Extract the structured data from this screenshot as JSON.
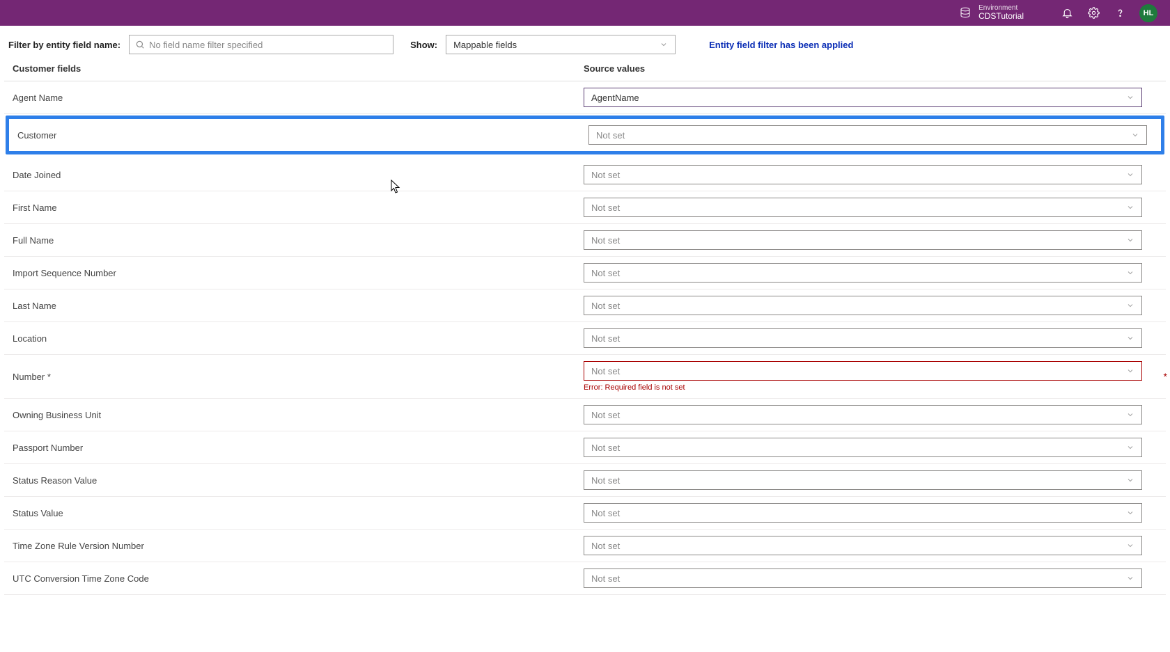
{
  "header": {
    "env_label": "Environment",
    "env_name": "CDSTutorial",
    "avatar_initials": "HL"
  },
  "filterbar": {
    "filter_label": "Filter by entity field name:",
    "search_placeholder": "No field name filter specified",
    "show_label": "Show:",
    "show_value": "Mappable fields",
    "applied_msg": "Entity field filter has been applied"
  },
  "columns": {
    "customer_fields": "Customer fields",
    "source_values": "Source values"
  },
  "placeholders": {
    "not_set": "Not set"
  },
  "rows": [
    {
      "label": "Agent Name",
      "value": "AgentName",
      "highlighted": false,
      "required": false,
      "error": null,
      "strong_border": true
    },
    {
      "label": "Customer",
      "value": null,
      "highlighted": true,
      "required": false,
      "error": null
    },
    {
      "label": "Date Joined",
      "value": null,
      "highlighted": false,
      "required": false,
      "error": null
    },
    {
      "label": "First Name",
      "value": null,
      "highlighted": false,
      "required": false,
      "error": null
    },
    {
      "label": "Full Name",
      "value": null,
      "highlighted": false,
      "required": false,
      "error": null
    },
    {
      "label": "Import Sequence Number",
      "value": null,
      "highlighted": false,
      "required": false,
      "error": null
    },
    {
      "label": "Last Name",
      "value": null,
      "highlighted": false,
      "required": false,
      "error": null
    },
    {
      "label": "Location",
      "value": null,
      "highlighted": false,
      "required": false,
      "error": null
    },
    {
      "label": "Number *",
      "value": null,
      "highlighted": false,
      "required": true,
      "error": "Error: Required field is not set"
    },
    {
      "label": "Owning Business Unit",
      "value": null,
      "highlighted": false,
      "required": false,
      "error": null
    },
    {
      "label": "Passport Number",
      "value": null,
      "highlighted": false,
      "required": false,
      "error": null
    },
    {
      "label": "Status Reason Value",
      "value": null,
      "highlighted": false,
      "required": false,
      "error": null
    },
    {
      "label": "Status Value",
      "value": null,
      "highlighted": false,
      "required": false,
      "error": null
    },
    {
      "label": "Time Zone Rule Version Number",
      "value": null,
      "highlighted": false,
      "required": false,
      "error": null
    },
    {
      "label": "UTC Conversion Time Zone Code",
      "value": null,
      "highlighted": false,
      "required": false,
      "error": null
    }
  ]
}
